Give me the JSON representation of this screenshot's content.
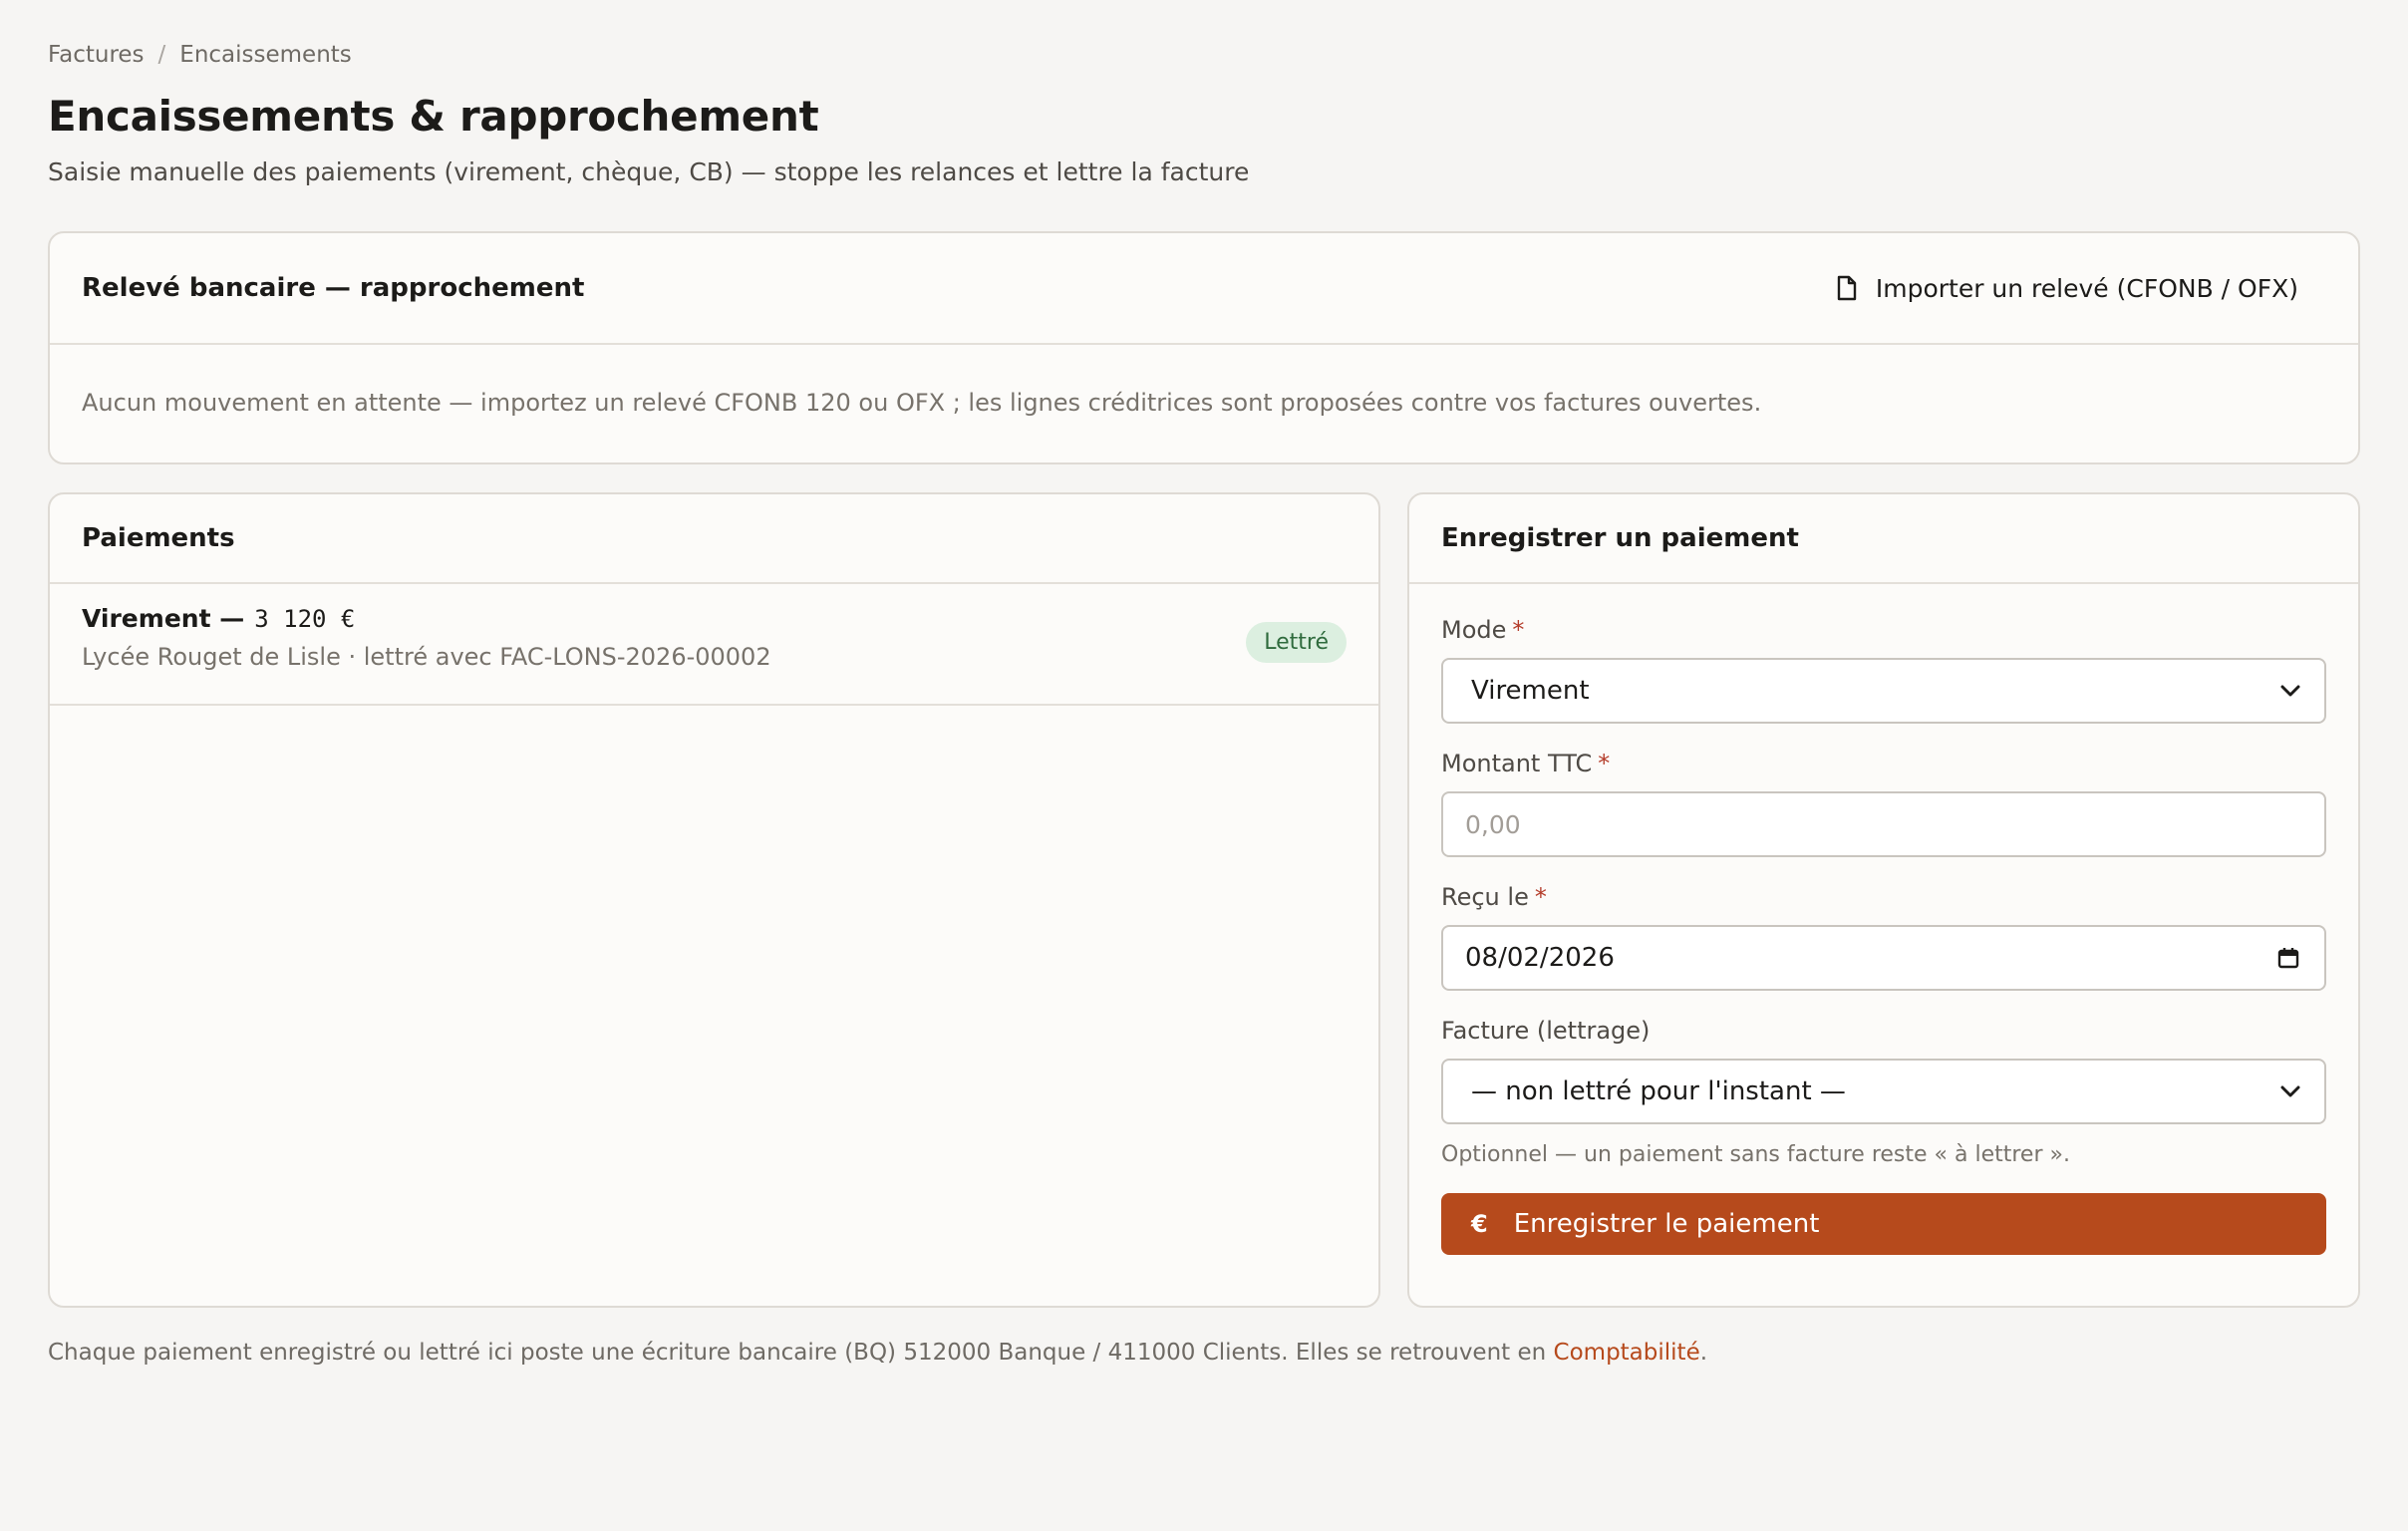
{
  "breadcrumb": {
    "parent": "Factures",
    "separator": "/",
    "current": "Encaissements"
  },
  "page": {
    "title": "Encaissements & rapprochement",
    "subtitle": "Saisie manuelle des paiements (virement, chèque, CB) — stoppe les relances et lettre la facture"
  },
  "bank": {
    "title": "Relevé bancaire — rapprochement",
    "import_label": "Importer un relevé (CFONB / OFX)",
    "import_icon": "document-icon",
    "empty_text": "Aucun mouvement en attente — importez un relevé CFONB 120 ou OFX ; les lignes créditrices sont proposées contre vos factures ouvertes."
  },
  "payments": {
    "title": "Paiements",
    "items": [
      {
        "mode": "Virement —",
        "amount": "3 120 €",
        "detail": "Lycée Rouget de Lisle · lettré avec FAC-LONS-2026-00002",
        "status": "Lettré"
      }
    ]
  },
  "form": {
    "title": "Enregistrer un paiement",
    "required_mark": "*",
    "mode_label": "Mode",
    "mode_value": "Virement",
    "amount_label": "Montant TTC",
    "amount_placeholder": "0,00",
    "date_label": "Reçu le",
    "date_value": "08/02/2026",
    "invoice_label": "Facture (lettrage)",
    "invoice_value": "— non lettré pour l'instant —",
    "invoice_hint": "Optionnel — un paiement sans facture reste « à lettrer ».",
    "submit_icon": "€",
    "submit_label": "Enregistrer le paiement"
  },
  "footer": {
    "text": "Chaque paiement enregistré ou lettré ici poste une écriture bancaire (BQ) 512000 Banque / 411000 Clients. Elles se retrouvent en ",
    "link": "Comptabilité",
    "end": "."
  },
  "colors": {
    "accent": "#b64a1c",
    "badge_bg": "#dcefe0",
    "badge_text": "#2f6b3d",
    "required": "#b43c2a"
  }
}
